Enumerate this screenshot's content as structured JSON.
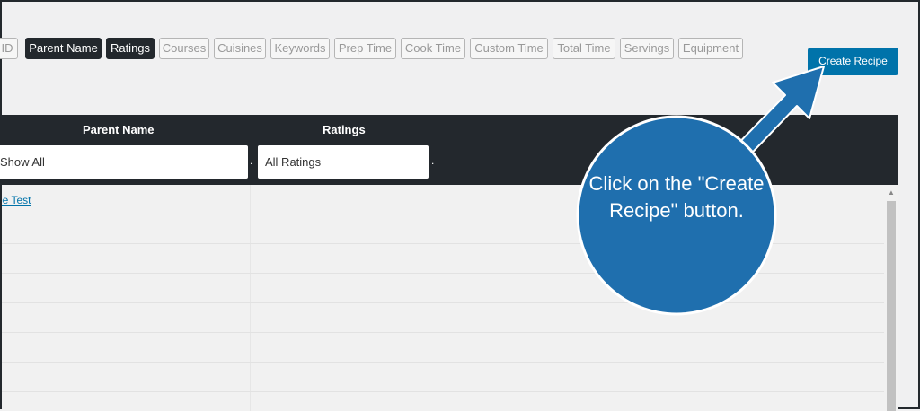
{
  "columns_toggle": [
    {
      "label": "ID",
      "active": false
    },
    {
      "label": "Parent Name",
      "active": true
    },
    {
      "label": "Ratings",
      "active": true
    },
    {
      "label": "Courses",
      "active": false
    },
    {
      "label": "Cuisines",
      "active": false
    },
    {
      "label": "Keywords",
      "active": false
    },
    {
      "label": "Prep Time",
      "active": false
    },
    {
      "label": "Cook Time",
      "active": false
    },
    {
      "label": "Custom Time",
      "active": false
    },
    {
      "label": "Total Time",
      "active": false
    },
    {
      "label": "Servings",
      "active": false
    },
    {
      "label": "Equipment",
      "active": false
    }
  ],
  "create_button": {
    "label": "Create Recipe"
  },
  "table": {
    "headers": {
      "parent_name": "Parent Name",
      "ratings": "Ratings"
    },
    "filters": {
      "parent_name_value": "Show All",
      "ratings_value": "All Ratings"
    },
    "rows": [
      {
        "name": "Recipe Test"
      },
      {
        "name": ""
      },
      {
        "name": ""
      },
      {
        "name": ""
      },
      {
        "name": ""
      },
      {
        "name": ""
      },
      {
        "name": ""
      },
      {
        "name": ""
      }
    ]
  },
  "callout": {
    "text": "Click on the \"Create Recipe\" button."
  },
  "colors": {
    "accent": "#0073aa",
    "header_dark": "#23282d",
    "callout_blue": "#1f6fae"
  }
}
